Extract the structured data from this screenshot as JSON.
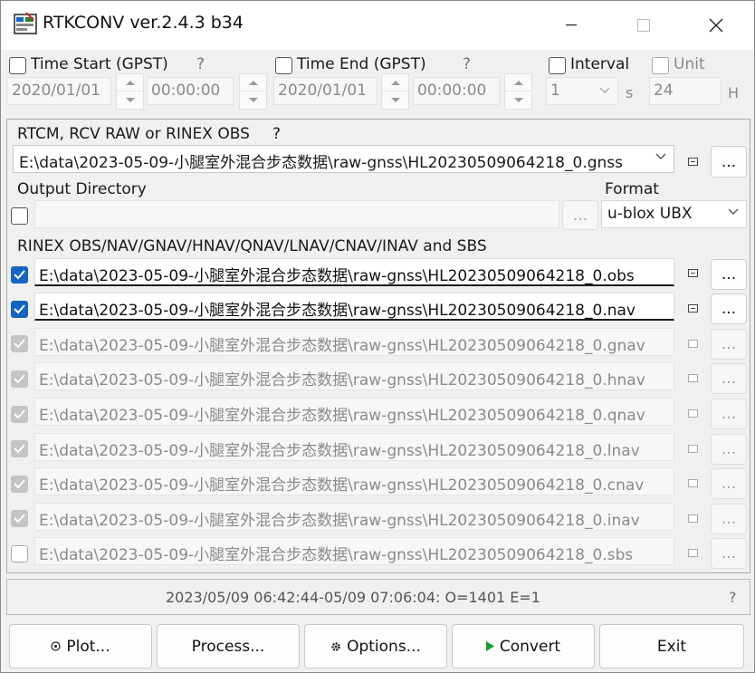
{
  "window": {
    "title": "RTKCONV ver.2.4.3 b34"
  },
  "time": {
    "time_start_label": "Time Start (GPST)",
    "time_end_label": "Time End (GPST)",
    "help_mark": "?",
    "start_date": "2020/01/01",
    "start_time": "00:00:00",
    "end_date": "2020/01/01",
    "end_time": "00:00:00",
    "interval_label": "Interval",
    "interval_value": "1",
    "interval_unit": "s",
    "unit_label": "Unit",
    "unit_value": "24",
    "unit_suffix": "H"
  },
  "input": {
    "label": "RTCM, RCV RAW or RINEX OBS",
    "help_mark": "?",
    "file": "E:\\data\\2023-05-09-小腿室外混合步态数据\\raw-gnss\\HL20230509064218_0.gnss",
    "browse_label": "..."
  },
  "output": {
    "dir_label": "Output Directory",
    "dir_value": "",
    "browse_label": "...",
    "format_label": "Format",
    "format_value": "u-blox UBX"
  },
  "rinex": {
    "label": "RINEX OBS/NAV/GNAV/HNAV/QNAV/LNAV/CNAV/INAV and SBS",
    "browse_label": "...",
    "files": [
      {
        "path": "E:\\data\\2023-05-09-小腿室外混合步态数据\\raw-gnss\\HL20230509064218_0.obs"
      },
      {
        "path": "E:\\data\\2023-05-09-小腿室外混合步态数据\\raw-gnss\\HL20230509064218_0.nav"
      },
      {
        "path": "E:\\data\\2023-05-09-小腿室外混合步态数据\\raw-gnss\\HL20230509064218_0.gnav"
      },
      {
        "path": "E:\\data\\2023-05-09-小腿室外混合步态数据\\raw-gnss\\HL20230509064218_0.hnav"
      },
      {
        "path": "E:\\data\\2023-05-09-小腿室外混合步态数据\\raw-gnss\\HL20230509064218_0.qnav"
      },
      {
        "path": "E:\\data\\2023-05-09-小腿室外混合步态数据\\raw-gnss\\HL20230509064218_0.lnav"
      },
      {
        "path": "E:\\data\\2023-05-09-小腿室外混合步态数据\\raw-gnss\\HL20230509064218_0.cnav"
      },
      {
        "path": "E:\\data\\2023-05-09-小腿室外混合步态数据\\raw-gnss\\HL20230509064218_0.inav"
      },
      {
        "path": "E:\\data\\2023-05-09-小腿室外混合步态数据\\raw-gnss\\HL20230509064218_0.sbs"
      }
    ]
  },
  "status": {
    "text": "2023/05/09 06:42:44-05/09 07:06:04: O=1401 E=1",
    "help_mark": "?"
  },
  "buttons": {
    "plot": "Plot...",
    "process": "Process...",
    "options": "Options...",
    "convert": "Convert",
    "exit": "Exit"
  },
  "colors": {
    "accent": "#1565c0",
    "convert_arrow": "#1a9a2a"
  }
}
